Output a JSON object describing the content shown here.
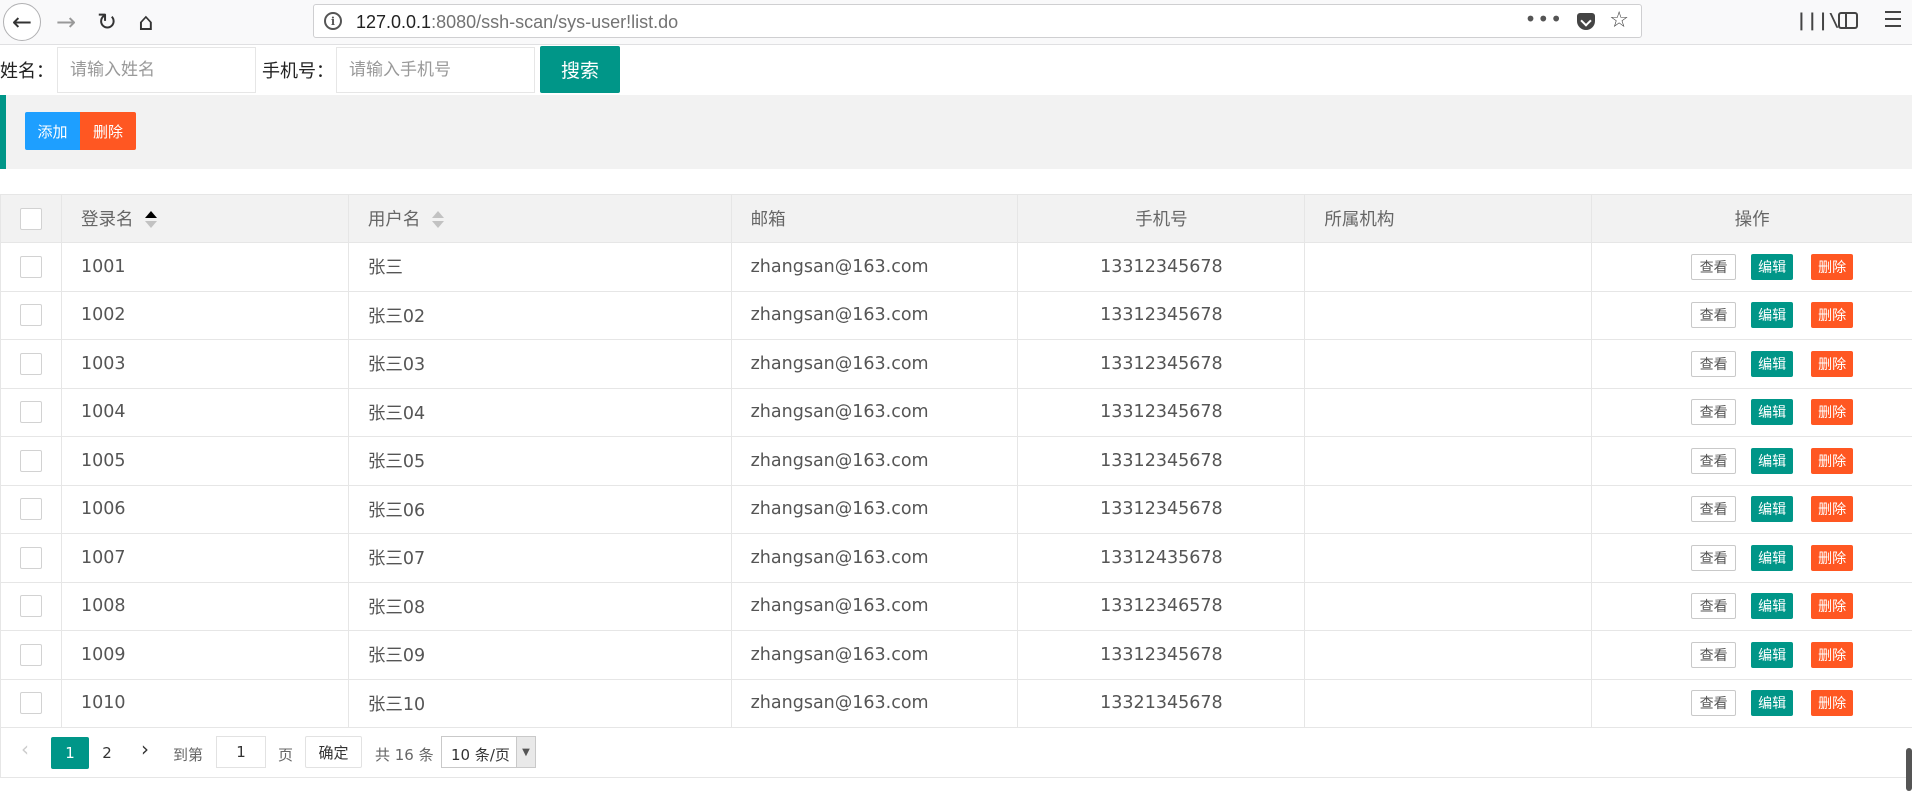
{
  "browser": {
    "url_host": "127.0.0.1",
    "url_rest": ":8080/ssh-scan/sys-user!list.do"
  },
  "search": {
    "name_label": "姓名：",
    "name_placeholder": "请输入姓名",
    "phone_label": "手机号：",
    "phone_placeholder": "请输入手机号",
    "search_button": "搜索"
  },
  "toolbar": {
    "add_label": "添加",
    "delete_label": "删除"
  },
  "table": {
    "headers": [
      "登录名",
      "用户名",
      "邮箱",
      "手机号",
      "所属机构",
      "操作"
    ],
    "rows": [
      {
        "login": "1001",
        "name": "张三",
        "email": "zhangsan@163.com",
        "phone": "13312345678",
        "org": ""
      },
      {
        "login": "1002",
        "name": "张三02",
        "email": "zhangsan@163.com",
        "phone": "13312345678",
        "org": ""
      },
      {
        "login": "1003",
        "name": "张三03",
        "email": "zhangsan@163.com",
        "phone": "13312345678",
        "org": ""
      },
      {
        "login": "1004",
        "name": "张三04",
        "email": "zhangsan@163.com",
        "phone": "13312345678",
        "org": ""
      },
      {
        "login": "1005",
        "name": "张三05",
        "email": "zhangsan@163.com",
        "phone": "13312345678",
        "org": ""
      },
      {
        "login": "1006",
        "name": "张三06",
        "email": "zhangsan@163.com",
        "phone": "13312345678",
        "org": ""
      },
      {
        "login": "1007",
        "name": "张三07",
        "email": "zhangsan@163.com",
        "phone": "13312435678",
        "org": ""
      },
      {
        "login": "1008",
        "name": "张三08",
        "email": "zhangsan@163.com",
        "phone": "13312346578",
        "org": ""
      },
      {
        "login": "1009",
        "name": "张三09",
        "email": "zhangsan@163.com",
        "phone": "13312345678",
        "org": ""
      },
      {
        "login": "1010",
        "name": "张三10",
        "email": "zhangsan@163.com",
        "phone": "13321345678",
        "org": ""
      }
    ],
    "actions": {
      "view": "查看",
      "edit": "编辑",
      "delete": "删除"
    }
  },
  "pagination": {
    "prev": "‹",
    "current_page": "1",
    "page_2": "2",
    "next": "›",
    "goto_label": "到第",
    "goto_value": "1",
    "page_unit": "页",
    "confirm": "确定",
    "total": "共 16 条",
    "page_size": "10 条/页"
  },
  "colors": {
    "primary": "#009688",
    "normal": "#1e9fff",
    "danger": "#ff5722"
  }
}
